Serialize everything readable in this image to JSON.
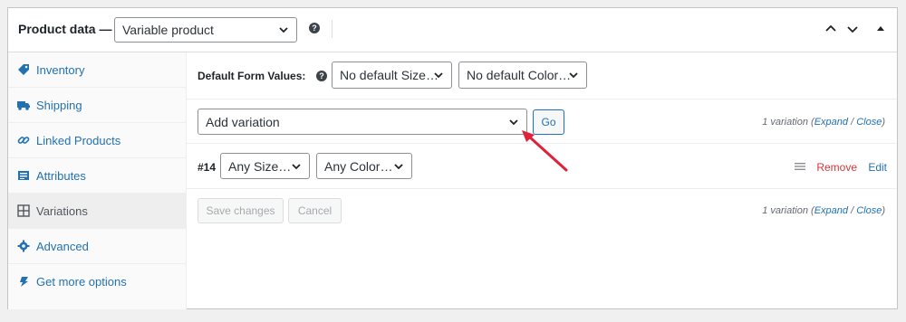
{
  "header": {
    "title": "Product data —",
    "product_type": "Variable product",
    "help": "?"
  },
  "sidebar": {
    "items": [
      {
        "label": "Inventory",
        "icon": "tag-icon"
      },
      {
        "label": "Shipping",
        "icon": "truck-icon"
      },
      {
        "label": "Linked Products",
        "icon": "link-icon"
      },
      {
        "label": "Attributes",
        "icon": "list-icon"
      },
      {
        "label": "Variations",
        "icon": "grid-icon",
        "active": true
      },
      {
        "label": "Advanced",
        "icon": "gear-icon"
      },
      {
        "label": "Get more options",
        "icon": "plugin-icon"
      }
    ]
  },
  "defaults": {
    "label": "Default Form Values:",
    "size": "No default Size…",
    "color": "No default Color…"
  },
  "add_variation": {
    "select": "Add variation",
    "go": "Go",
    "count": "1 variation",
    "expand": "Expand",
    "slash": "/",
    "close": "Close"
  },
  "variation": {
    "number": "#14",
    "size": "Any Size…",
    "color": "Any Color…",
    "remove": "Remove",
    "edit": "Edit"
  },
  "footer": {
    "save": "Save changes",
    "cancel": "Cancel",
    "count": "1 variation",
    "expand": "Expand",
    "slash": "/",
    "close": "Close"
  },
  "colors": {
    "link": "#2271b1",
    "danger": "#d63638",
    "annotation_arrow": "#e0213a"
  }
}
